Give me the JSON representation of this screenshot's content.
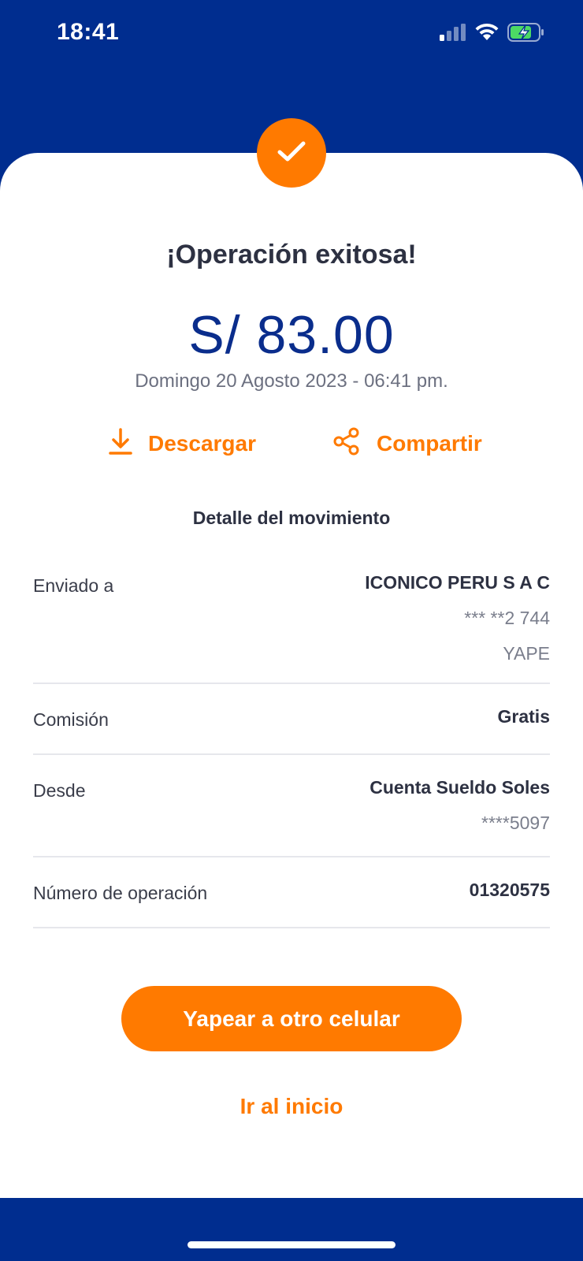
{
  "status_bar": {
    "time": "18:41",
    "icons": [
      "signal-icon",
      "wifi-icon",
      "battery-charging-icon"
    ]
  },
  "header": {
    "check_icon": "check-icon",
    "title": "¡Operación exitosa!",
    "amount": "S/ 83.00",
    "datetime": "Domingo 20 Agosto 2023 - 06:41 pm."
  },
  "actions": {
    "download_label": "Descargar",
    "share_label": "Compartir"
  },
  "detail": {
    "title": "Detalle del movimiento",
    "rows": [
      {
        "label": "Enviado a",
        "main": "ICONICO PERU S A C",
        "subs": [
          "*** **2 744",
          "YAPE"
        ]
      },
      {
        "label": "Comisión",
        "main": "Gratis",
        "subs": []
      },
      {
        "label": "Desde",
        "main": "Cuenta Sueldo Soles",
        "subs": [
          "****5097"
        ]
      },
      {
        "label": "Número de operación",
        "main": "01320575",
        "subs": []
      }
    ]
  },
  "buttons": {
    "primary": "Yapear a otro celular",
    "secondary": "Ir al inicio"
  },
  "colors": {
    "brand_blue": "#002d8f",
    "accent_orange": "#ff7a00",
    "amount_blue": "#0a2d8c"
  }
}
